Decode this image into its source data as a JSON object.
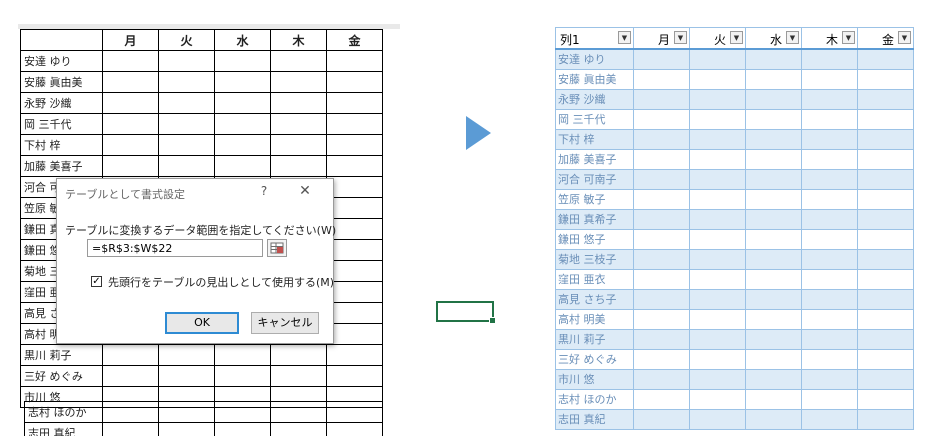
{
  "left_sheet": {
    "days": [
      "月",
      "火",
      "水",
      "木",
      "金"
    ],
    "names": [
      "安達 ゆり",
      "安藤 眞由美",
      "永野 沙織",
      "岡 三千代",
      "下村 梓",
      "加藤 美喜子",
      "河合 可南子",
      "笠原 敏子",
      "鎌田 真希子",
      "鎌田 悠子",
      "菊地 三枝子",
      "窪田 亜衣",
      "高見 さち子",
      "高村 明美",
      "黒川 莉子",
      "三好 めぐみ",
      "市川 悠"
    ],
    "tail_names": [
      "志村 ほのか",
      "志田 真紀"
    ]
  },
  "dialog": {
    "title": "テーブルとして書式設定",
    "help": "?",
    "close": "✕",
    "prompt": "テーブルに変換するデータ範囲を指定してください(W)",
    "range_value": "=$R$3:$W$22",
    "checkbox_mark": "✓",
    "checkbox_label": "先頭行をテーブルの見出しとして使用する(M)",
    "ok_label": "OK",
    "cancel_label": "キャンセル"
  },
  "right_table": {
    "headers": [
      "列1",
      "月",
      "火",
      "水",
      "木",
      "金"
    ],
    "dropdown_glyph": "▼",
    "names": [
      "安達 ゆり",
      "安藤 眞由美",
      "永野 沙織",
      "岡 三千代",
      "下村 梓",
      "加藤 美喜子",
      "河合 可南子",
      "笠原 敏子",
      "鎌田 真希子",
      "鎌田 悠子",
      "菊地 三枝子",
      "窪田 亜衣",
      "高見 さち子",
      "高村 明美",
      "黒川 莉子",
      "三好 めぐみ",
      "市川 悠",
      "志村 ほのか",
      "志田 真紀"
    ]
  },
  "colors": {
    "accent_blue": "#5b9bd5",
    "band_fill": "#ddebf7",
    "selection_green": "#217346"
  },
  "icons": {
    "arrow": "right-arrow-icon",
    "collapse": "range-collapse-icon",
    "dropdown": "filter-dropdown-icon"
  }
}
